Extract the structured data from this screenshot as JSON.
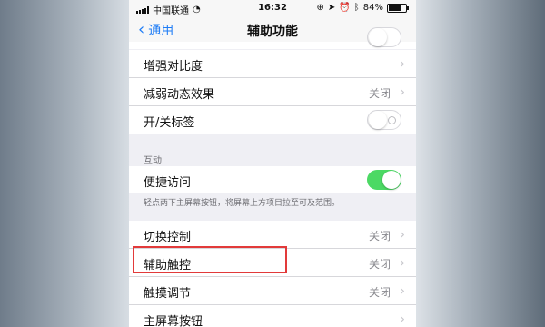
{
  "status_bar": {
    "carrier": "中国联通",
    "time": "16:32",
    "battery": "84%",
    "battery_level": 0.84
  },
  "nav": {
    "back_label": "通用",
    "title": "辅助功能"
  },
  "group1": {
    "items": [
      {
        "label": "增强对比度"
      },
      {
        "label": "减弱动态效果",
        "value": "关闭"
      },
      {
        "label": "开/关标签"
      }
    ]
  },
  "interaction": {
    "header": "互动",
    "items": [
      {
        "label": "便捷访问"
      }
    ],
    "footer": "轻点两下主屏幕按钮，将屏幕上方项目拉至可及范围。"
  },
  "group2": {
    "items": [
      {
        "label": "切换控制",
        "value": "关闭"
      },
      {
        "label": "辅助触控",
        "value": "关闭"
      },
      {
        "label": "触摸调节",
        "value": "关闭"
      },
      {
        "label": "主屏幕按钮"
      }
    ]
  },
  "colors": {
    "accent": "#1e7cf6",
    "toggle_on": "#4cd964",
    "highlight": "#e23a3a"
  }
}
